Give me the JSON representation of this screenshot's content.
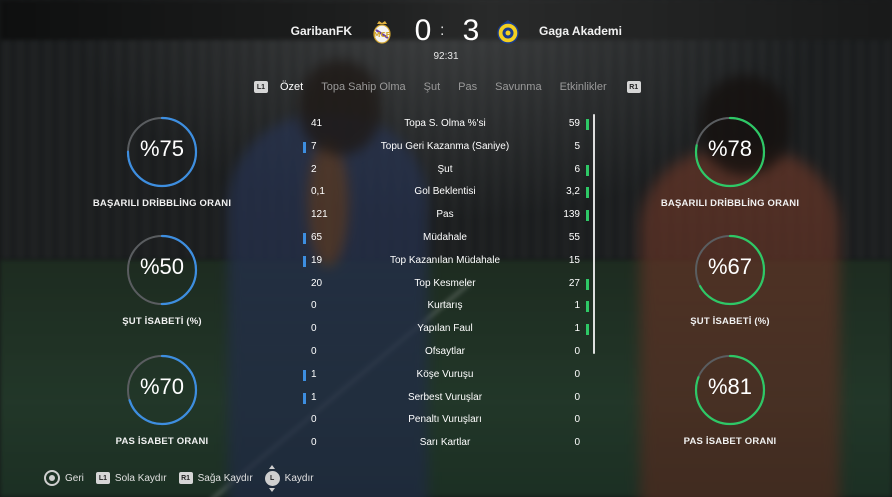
{
  "match": {
    "home_team": "GaribanFK",
    "away_team": "Gaga Akademi",
    "home_score": "0",
    "separator": ":",
    "away_score": "3",
    "clock": "92:31",
    "home_crest_icon": "real-madrid-crest-icon",
    "away_crest_icon": "al-nassr-crest-icon"
  },
  "tabs": {
    "left_button": "L1",
    "right_button": "R1",
    "items": [
      "Özet",
      "Topa Sahip Olma",
      "Şut",
      "Pas",
      "Savunma",
      "Etkinlikler"
    ],
    "active_index": 0
  },
  "colors": {
    "home_accent": "#3d8ee0",
    "away_accent": "#2ec866",
    "gauge_track": "#5a5d60"
  },
  "stats": [
    {
      "name": "Topa S. Olma %'si",
      "home": "41",
      "away": "59",
      "leader": "away"
    },
    {
      "name": "Topu Geri Kazanma (Saniye)",
      "home": "7",
      "away": "5",
      "leader": "home"
    },
    {
      "name": "Şut",
      "home": "2",
      "away": "6",
      "leader": "away"
    },
    {
      "name": "Gol Beklentisi",
      "home": "0,1",
      "away": "3,2",
      "leader": "away"
    },
    {
      "name": "Pas",
      "home": "121",
      "away": "139",
      "leader": "away"
    },
    {
      "name": "Müdahale",
      "home": "65",
      "away": "55",
      "leader": "home"
    },
    {
      "name": "Top Kazanılan Müdahale",
      "home": "19",
      "away": "15",
      "leader": "home"
    },
    {
      "name": "Top Kesmeler",
      "home": "20",
      "away": "27",
      "leader": "away"
    },
    {
      "name": "Kurtarış",
      "home": "0",
      "away": "1",
      "leader": "away"
    },
    {
      "name": "Yapılan Faul",
      "home": "0",
      "away": "1",
      "leader": "away"
    },
    {
      "name": "Ofsaytlar",
      "home": "0",
      "away": "0",
      "leader": "none"
    },
    {
      "name": "Köşe Vuruşu",
      "home": "1",
      "away": "0",
      "leader": "home"
    },
    {
      "name": "Serbest Vuruşlar",
      "home": "1",
      "away": "0",
      "leader": "home"
    },
    {
      "name": "Penaltı Vuruşları",
      "home": "0",
      "away": "0",
      "leader": "none"
    },
    {
      "name": "Sarı Kartlar",
      "home": "0",
      "away": "0",
      "leader": "none"
    }
  ],
  "gauges": {
    "home": [
      {
        "value_text": "%75",
        "percent": 75,
        "label": "BAŞARILI DRİBBLİNG ORANI"
      },
      {
        "value_text": "%50",
        "percent": 50,
        "label": "ŞUT İSABETİ (%)"
      },
      {
        "value_text": "%70",
        "percent": 70,
        "label": "PAS İSABET ORANI"
      }
    ],
    "away": [
      {
        "value_text": "%78",
        "percent": 78,
        "label": "BAŞARILI DRİBBLİNG ORANI"
      },
      {
        "value_text": "%67",
        "percent": 67,
        "label": "ŞUT İSABETİ (%)"
      },
      {
        "value_text": "%81",
        "percent": 81,
        "label": "PAS İSABET ORANI"
      }
    ]
  },
  "footer": {
    "back_label": "Geri",
    "l1_button": "L1",
    "scroll_left_label": "Sola Kaydır",
    "r1_button": "R1",
    "scroll_right_label": "Sağa Kaydır",
    "stick_button": "L",
    "scroll_label": "Kaydır"
  }
}
